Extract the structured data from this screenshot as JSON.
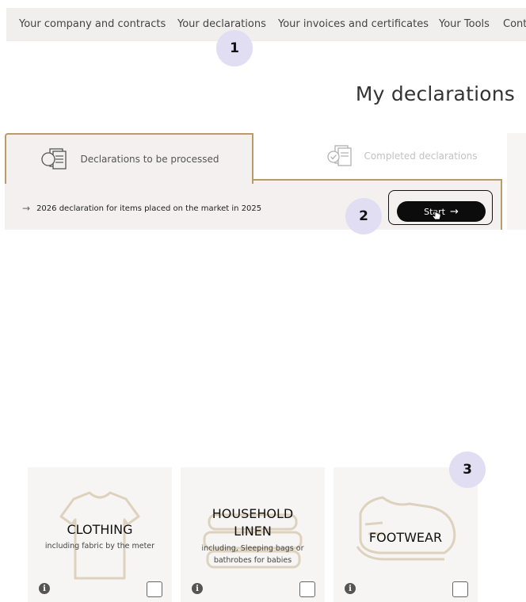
{
  "nav": {
    "items": [
      {
        "label": "Your company and contracts"
      },
      {
        "label": "Your declarations"
      },
      {
        "label": "Your invoices and certificates"
      },
      {
        "label": "Your Tools"
      },
      {
        "label": "Cont"
      }
    ]
  },
  "badges": {
    "step1": "1",
    "step2": "2",
    "step3": "3"
  },
  "page": {
    "title": "My declarations"
  },
  "tabs": {
    "active": {
      "label": "Declarations to be processed",
      "icon": "documents-icon"
    },
    "inactive": {
      "label": "Completed declarations",
      "icon": "completed-documents-icon"
    }
  },
  "declaration": {
    "text": "2026 declaration for items placed on the market in 2025",
    "start_label": "Start",
    "start_arrow": "→"
  },
  "categories": [
    {
      "title": "CLOTHING",
      "subtitle": "including fabric by the meter",
      "icon": "tshirt-icon"
    },
    {
      "title_line1": "HOUSEHOLD",
      "title_line2": "LINEN",
      "subtitle_line1": "including, Sleeping bags or",
      "subtitle_line2": "bathrobes for babies",
      "icon": "linen-stack-icon"
    },
    {
      "title": "FOOTWEAR",
      "icon": "shoe-icon"
    }
  ],
  "info_glyph": "i",
  "colors": {
    "accent_gold": "#b89d6a",
    "badge_lavender": "#e1def4",
    "button_black": "#0c0c0c",
    "card_bg": "#f6f5f3"
  }
}
